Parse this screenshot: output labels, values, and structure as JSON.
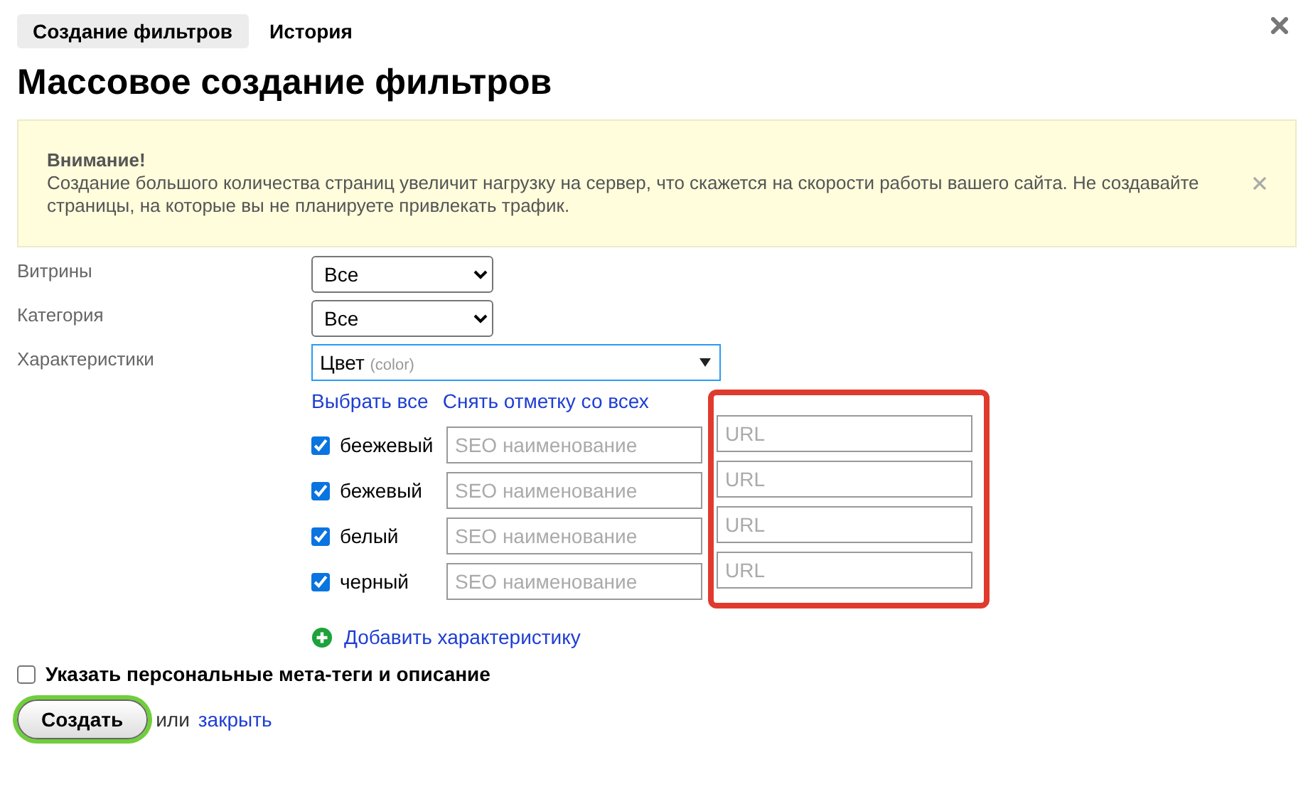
{
  "tabs": [
    {
      "label": "Создание фильтров",
      "selected": true
    },
    {
      "label": "История",
      "selected": false
    }
  ],
  "title": "Массовое создание фильтров",
  "notice": {
    "heading": "Внимание!",
    "text": "Создание большого количества страниц увеличит нагрузку на сервер, что скажется на скорости работы вашего сайта. Не создавайте страницы, на которые вы не планируете привлекать трафик."
  },
  "fields": [
    {
      "label": "Витрины",
      "kind": "select",
      "value": "Все"
    },
    {
      "label": "Категория",
      "kind": "select",
      "value": "Все"
    },
    {
      "label": "Характеристики",
      "kind": "combo",
      "value": "Цвет",
      "hint": "(color)"
    }
  ],
  "links": [
    "Выбрать все",
    "Снять отметку со всех"
  ],
  "values": [
    {
      "label": "беежевый",
      "checked": true,
      "seo_placeholder": "SEO наименование",
      "url_placeholder": "URL"
    },
    {
      "label": "бежевый",
      "checked": true,
      "seo_placeholder": "SEO наименование",
      "url_placeholder": "URL"
    },
    {
      "label": "белый",
      "checked": true,
      "seo_placeholder": "SEO наименование",
      "url_placeholder": "URL"
    },
    {
      "label": "черный",
      "checked": true,
      "seo_placeholder": "SEO наименование",
      "url_placeholder": "URL"
    }
  ],
  "add_link": "Добавить характеристику",
  "meta_option": {
    "label": "Указать персональные мета-теги и описание",
    "checked": false
  },
  "submit": "Создать",
  "or_text": "или",
  "close_link": "закрыть"
}
